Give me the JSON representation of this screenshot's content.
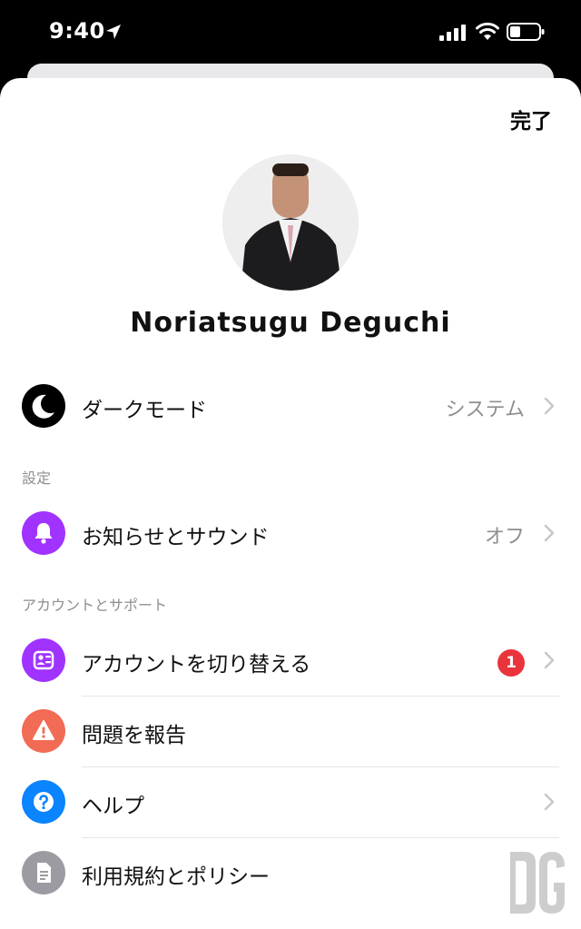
{
  "status_bar": {
    "time": "9:40"
  },
  "header": {
    "done_label": "完了"
  },
  "profile": {
    "name": "Noriatsugu Deguchi"
  },
  "dark_mode": {
    "label": "ダークモード",
    "value": "システム"
  },
  "sections": {
    "settings": {
      "title": "設定"
    },
    "account_support": {
      "title": "アカウントとサポート"
    }
  },
  "notifications": {
    "label": "お知らせとサウンド",
    "value": "オフ"
  },
  "switch_account": {
    "label": "アカウントを切り替える",
    "badge": "1"
  },
  "report_problem": {
    "label": "問題を報告"
  },
  "help": {
    "label": "ヘルプ"
  },
  "terms": {
    "label": "利用規約とポリシー"
  },
  "colors": {
    "dark_icon_bg": "#000000",
    "purple": "#a033ff",
    "coral": "#f26b55",
    "blue": "#0a84ff",
    "grey": "#9b9ba1",
    "badge_red": "#e9343c"
  },
  "icons": {
    "dark_mode": "moon-icon",
    "notifications": "bell-icon",
    "switch_account": "switch-account-icon",
    "report_problem": "warning-icon",
    "help": "question-icon",
    "terms": "document-icon"
  }
}
